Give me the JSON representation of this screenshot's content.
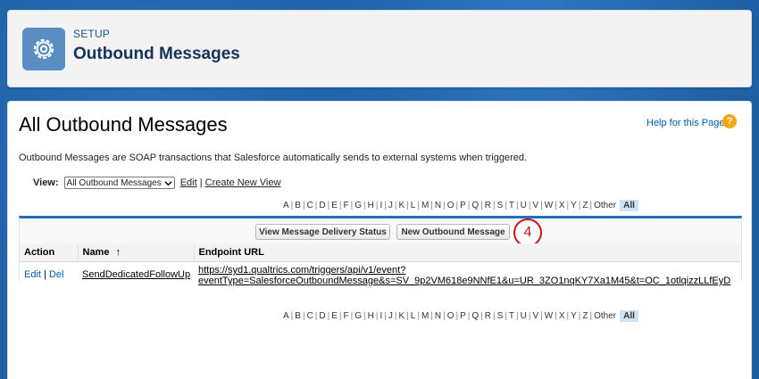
{
  "header": {
    "eyebrow": "SETUP",
    "title": "Outbound Messages",
    "icon": "gear-icon"
  },
  "main": {
    "title": "All Outbound Messages",
    "help_link": "Help for this Page",
    "help_icon": "?",
    "description": "Outbound Messages are SOAP transactions that Salesforce automatically sends to external systems when triggered.",
    "view": {
      "label": "View:",
      "selected": "All Outbound Messages",
      "edit_link": "Edit",
      "separator": "|",
      "create_link": "Create New View"
    },
    "alphabet": [
      "A",
      "B",
      "C",
      "D",
      "E",
      "F",
      "G",
      "H",
      "I",
      "J",
      "K",
      "L",
      "M",
      "N",
      "O",
      "P",
      "Q",
      "R",
      "S",
      "T",
      "U",
      "V",
      "W",
      "X",
      "Y",
      "Z",
      "Other"
    ],
    "alphabet_all": "All",
    "buttons": {
      "delivery_status": "View Message Delivery Status",
      "new_message": "New Outbound Message"
    },
    "step_badge": "4",
    "table": {
      "columns": [
        "Action",
        "Name",
        "Endpoint URL"
      ],
      "sort_indicator": "↑",
      "rows": [
        {
          "edit": "Edit",
          "sep": "|",
          "del": "Del",
          "name": "SendDedicatedFollowUp",
          "endpoint_line1": "https://syd1.qualtrics.com/triggers/api/v1/event?",
          "endpoint_line2": "eventType=SalesforceOutboundMessage&s=SV_9p2VM618e9NNfE1&u=UR_3ZO1nqKY7Xa1M45&t=OC_1otlqizzLLfEyD"
        }
      ]
    }
  },
  "colors": {
    "background": "#1d60a6",
    "accent": "#236fbd",
    "link": "#015ba7",
    "badge": "#c4161c",
    "help": "#f3a614"
  }
}
